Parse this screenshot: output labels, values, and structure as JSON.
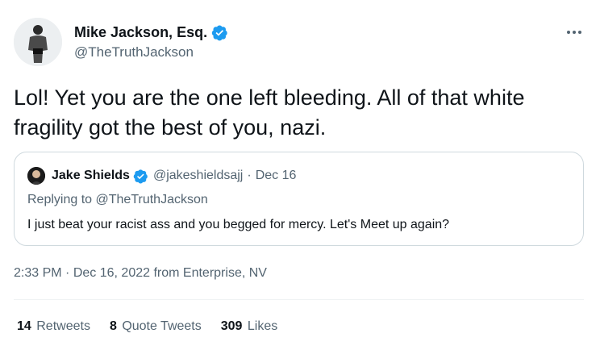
{
  "tweet": {
    "author": {
      "name": "Mike Jackson, Esq.",
      "handle": "@TheTruthJackson",
      "avatar_icon": "user-avatar"
    },
    "text": "Lol! Yet you are the one left bleeding. All of that white fragility got the best of you, nazi.",
    "more_icon": "more-options-icon",
    "quoted": {
      "author_name": "Jake Shields",
      "author_handle": "@jakeshieldsajj",
      "separator": "·",
      "date": "Dec 16",
      "replying_prefix": "Replying to",
      "replying_to": "@TheTruthJackson",
      "text": "I just beat your racist ass and you begged for mercy.  Let's Meet up again?"
    },
    "time": "2:33 PM",
    "time_sep": "·",
    "date": "Dec 16, 2022",
    "source": "from Enterprise, NV",
    "stats": [
      {
        "count": "14",
        "label": "Retweets"
      },
      {
        "count": "8",
        "label": "Quote Tweets"
      },
      {
        "count": "309",
        "label": "Likes"
      }
    ]
  },
  "colors": {
    "verified_blue": "#1d9bf0",
    "text_primary": "#0f1419",
    "text_secondary": "#536471",
    "border": "#cfd9de"
  }
}
